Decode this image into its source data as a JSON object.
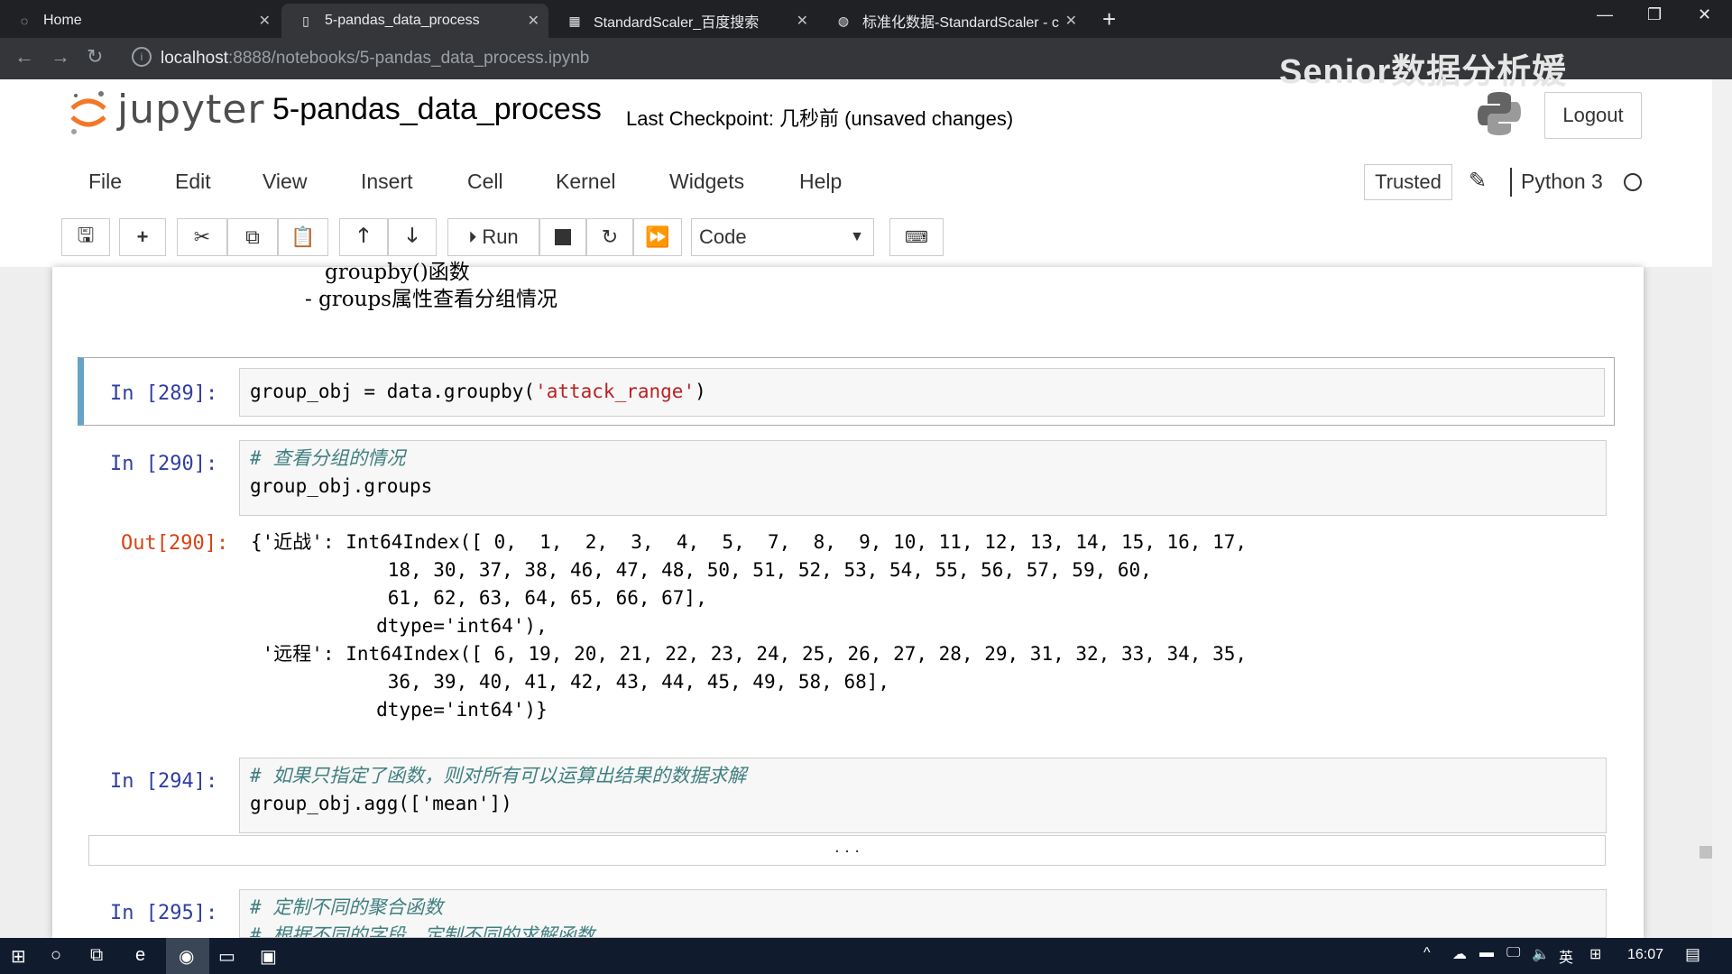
{
  "browser": {
    "tabs": [
      {
        "title": "Home",
        "icon": "jupyter-spinner-icon"
      },
      {
        "title": "5-pandas_data_process",
        "icon": "notebook-icon"
      },
      {
        "title": "StandardScaler_百度搜索",
        "icon": "baidu-icon"
      },
      {
        "title": "标准化数据-StandardScaler - c",
        "icon": "page-icon"
      }
    ],
    "new_tab": "+",
    "url_host": "localhost",
    "url_path": ":8888/notebooks/5-pandas_data_process.ipynb",
    "watermark": "Senior数据分析媛"
  },
  "header": {
    "logo_text": "jupyter",
    "notebook_name": "5-pandas_data_process",
    "checkpoint": "Last Checkpoint: 几秒前   (unsaved changes)",
    "logout": "Logout"
  },
  "menu": [
    "File",
    "Edit",
    "View",
    "Insert",
    "Cell",
    "Kernel",
    "Widgets",
    "Help"
  ],
  "status": {
    "trusted": "Trusted",
    "kernel": "Python 3"
  },
  "toolbar": {
    "run": "Run",
    "cell_type": "Code"
  },
  "notebook": {
    "md_cut": "groupby()函数",
    "md_line": "- groups属性查看分组情况",
    "cells": [
      {
        "prompt": "In  [289]:",
        "code": "group_obj = data.groupby('attack_range')"
      },
      {
        "prompt": "In  [290]:",
        "comment": "# 查看分组的情况",
        "code": "group_obj.groups"
      },
      {
        "prompt": "In  [294]:",
        "comment": "# 如果只指定了函数，则对所有可以运算出结果的数据求解",
        "code": "group_obj.agg(['mean'])"
      },
      {
        "prompt": "In  [295]:",
        "comment": "# 定制不同的聚合函数",
        "comment2": "# 根据不同的字段，定制不同的求解函数"
      }
    ],
    "output_prompt": "Out[290]:",
    "output_lines": [
      "{'近战': Int64Index([ 0,  1,  2,  3,  4,  5,  7,  8,  9, 10, 11, 12, 13, 14, 15, 16, 17,",
      "            18, 30, 37, 38, 46, 47, 48, 50, 51, 52, 53, 54, 55, 56, 57, 59, 60,",
      "            61, 62, 63, 64, 65, 66, 67],",
      "           dtype='int64'),",
      " '远程': Int64Index([ 6, 19, 20, 21, 22, 23, 24, 25, 26, 27, 28, 29, 31, 32, 33, 34, 35,",
      "            36, 39, 40, 41, 42, 43, 44, 45, 49, 58, 68],",
      "           dtype='int64')}"
    ],
    "collapsed_marker": ". . ."
  },
  "taskbar": {
    "time": "16:07",
    "ime": "英"
  }
}
